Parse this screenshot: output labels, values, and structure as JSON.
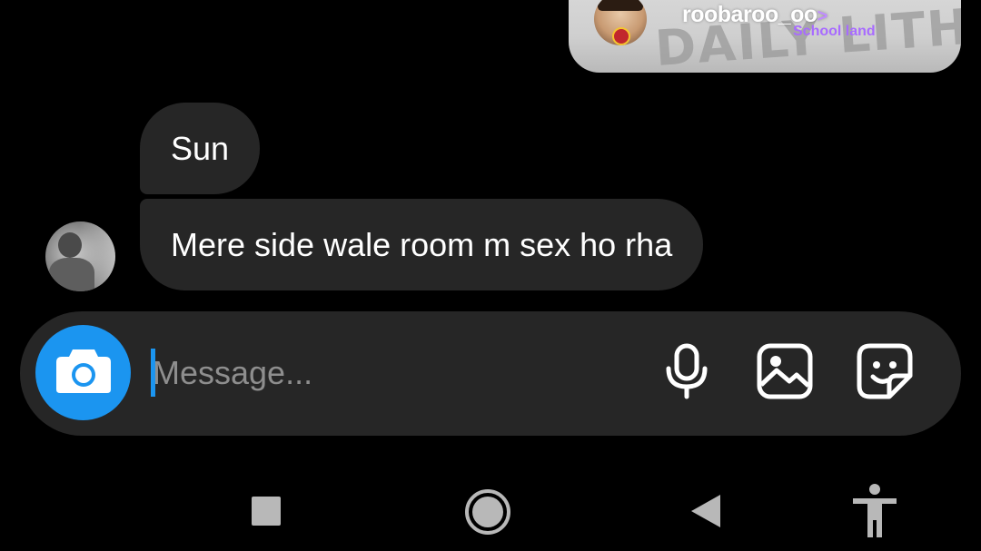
{
  "story": {
    "username": "roobaroo_oo",
    "arrow": ">",
    "subtitle": "School land",
    "background_text": "DAILY LITH"
  },
  "messages": [
    {
      "text": "Sun"
    },
    {
      "text": "Mere side wale room m sex ho rha"
    }
  ],
  "composer": {
    "placeholder": "Message..."
  },
  "icons": {
    "camera": "camera-icon",
    "mic": "microphone-icon",
    "gallery": "image-icon",
    "sticker": "sticker-icon",
    "recent": "recent-apps-icon",
    "home": "home-icon",
    "back": "back-icon",
    "accessibility": "accessibility-icon"
  },
  "colors": {
    "background": "#000000",
    "bubble": "#262626",
    "accent": "#1b95f0",
    "story_label": "#a86bff"
  }
}
